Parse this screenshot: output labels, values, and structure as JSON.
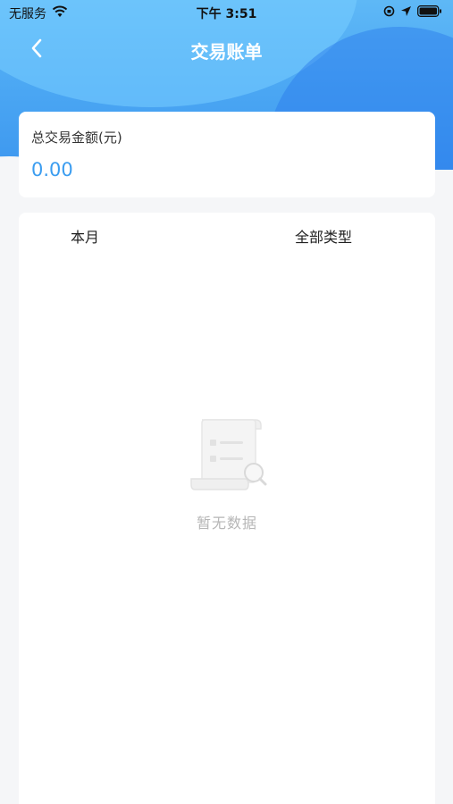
{
  "status_bar": {
    "carrier": "无服务",
    "time": "下午 3:51"
  },
  "nav": {
    "title": "交易账单",
    "back_icon": "chevron-left-icon"
  },
  "summary": {
    "label": "总交易金额(元)",
    "amount": "0.00"
  },
  "filters": {
    "month": "本月",
    "type": "全部类型"
  },
  "empty_state": {
    "icon": "empty-document-search-icon",
    "text": "暂无数据"
  },
  "colors": {
    "accent": "#3b9df0",
    "header_gradient_start": "#5eb8f6",
    "header_gradient_end": "#3d97ef",
    "background": "#f5f6f8",
    "empty_text": "#b6b6b6"
  }
}
